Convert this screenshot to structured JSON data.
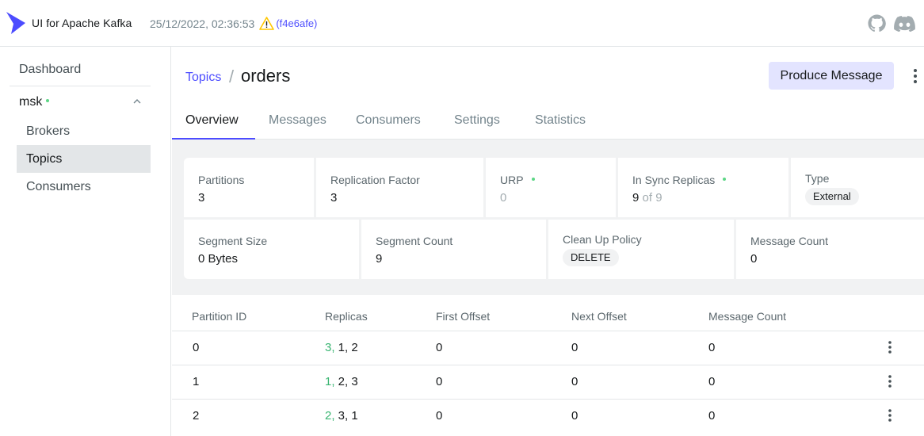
{
  "app": {
    "brand": "UI for Apache Kafka",
    "build_time": "25/12/2022, 02:36:53",
    "commit": "(f4e6afe)",
    "icons": [
      "kafka-logo",
      "warning-icon",
      "github-icon",
      "discord-icon"
    ]
  },
  "colors": {
    "accent": "#4c4cff",
    "online": "#5cd685",
    "leader": "#3ab572",
    "warning": "#ffc700"
  },
  "sidebar": {
    "dashboard": "Dashboard",
    "cluster": "msk",
    "items": [
      {
        "label": "Brokers"
      },
      {
        "label": "Topics",
        "active": true
      },
      {
        "label": "Consumers"
      }
    ]
  },
  "page": {
    "breadcrumb_link": "Topics",
    "breadcrumb_sep": "/",
    "title": "orders",
    "produce_label": "Produce Message"
  },
  "tabs": [
    {
      "label": "Overview",
      "active": true
    },
    {
      "label": "Messages"
    },
    {
      "label": "Consumers"
    },
    {
      "label": "Settings"
    },
    {
      "label": "Statistics"
    }
  ],
  "stats": {
    "partitions": {
      "label": "Partitions",
      "value": "3"
    },
    "replication_factor": {
      "label": "Replication Factor",
      "value": "3"
    },
    "urp": {
      "label": "URP",
      "value": "0"
    },
    "in_sync": {
      "label": "In Sync Replicas",
      "value": "9",
      "of": "of 9"
    },
    "type": {
      "label": "Type",
      "value": "External"
    },
    "segment_size": {
      "label": "Segment Size",
      "value": "0 Bytes"
    },
    "segment_count": {
      "label": "Segment Count",
      "value": "9"
    },
    "cleanup_policy": {
      "label": "Clean Up Policy",
      "value": "DELETE"
    },
    "message_count": {
      "label": "Message Count",
      "value": "0"
    }
  },
  "table": {
    "columns": [
      "Partition ID",
      "Replicas",
      "First Offset",
      "Next Offset",
      "Message Count"
    ],
    "rows": [
      {
        "partition": "0",
        "leader": "3,",
        "replicas": " 1, 2",
        "first": "0",
        "next": "0",
        "count": "0"
      },
      {
        "partition": "1",
        "leader": "1,",
        "replicas": " 2, 3",
        "first": "0",
        "next": "0",
        "count": "0"
      },
      {
        "partition": "2",
        "leader": "2,",
        "replicas": " 3, 1",
        "first": "0",
        "next": "0",
        "count": "0"
      }
    ]
  }
}
